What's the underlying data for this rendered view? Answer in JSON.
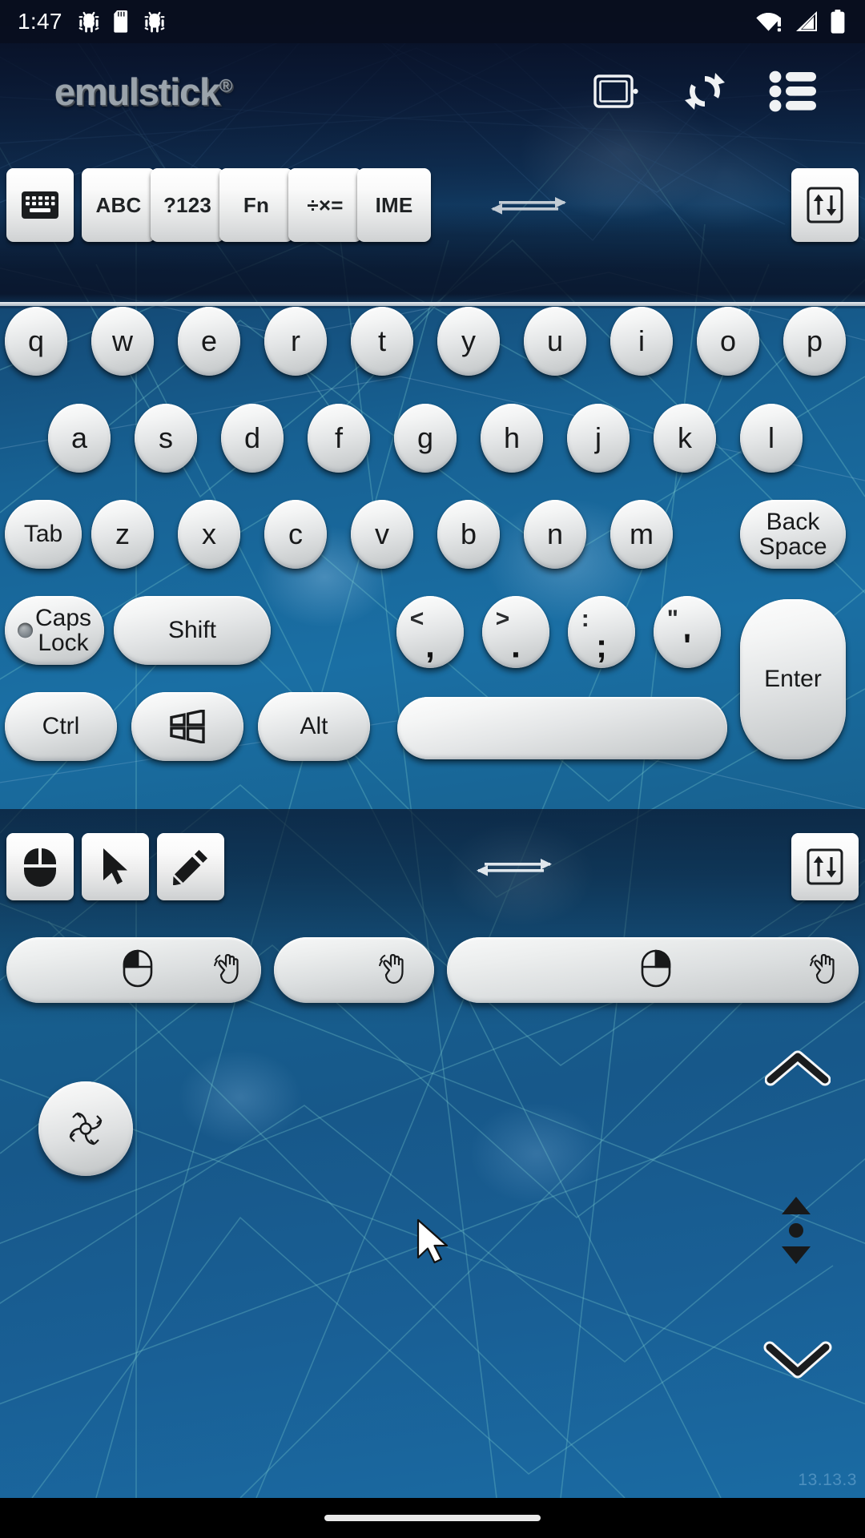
{
  "status_bar": {
    "clock": "1:47",
    "left_icons": [
      "bug-android-icon",
      "sd-card-icon",
      "bug-android-icon"
    ],
    "right_icons": [
      "wifi-no-internet-icon",
      "cellular-signal-icon",
      "battery-full-icon"
    ]
  },
  "header": {
    "logo_text": "emulstick",
    "logo_registered": "®",
    "icons": [
      {
        "name": "device-screen-icon",
        "label": "Device"
      },
      {
        "name": "sync-refresh-icon",
        "label": "Sync"
      },
      {
        "name": "list-menu-icon",
        "label": "Menu"
      }
    ]
  },
  "mode_row": {
    "buttons": [
      {
        "name": "keyboard-toggle",
        "label": "",
        "icon": "keyboard-icon",
        "active": true
      },
      {
        "name": "abc-mode",
        "label": "ABC"
      },
      {
        "name": "num-sym-mode",
        "label": "?123"
      },
      {
        "name": "fn-mode",
        "label": "Fn"
      },
      {
        "name": "math-mode",
        "label": "÷×="
      },
      {
        "name": "ime-mode",
        "label": "IME"
      }
    ],
    "resize_handle": "horizontal-resize-arrows-icon",
    "collapse_button": {
      "name": "keyboard-height-toggle",
      "icon": "up-down-arrows-boxed-icon"
    }
  },
  "keyboard": {
    "row1": [
      "q",
      "w",
      "e",
      "r",
      "t",
      "y",
      "u",
      "i",
      "o",
      "p"
    ],
    "row2": [
      "a",
      "s",
      "d",
      "f",
      "g",
      "h",
      "j",
      "k",
      "l"
    ],
    "row3": {
      "tab": "Tab",
      "letters": [
        "z",
        "x",
        "c",
        "v",
        "b",
        "n",
        "m"
      ],
      "backspace_line1": "Back",
      "backspace_line2": "Space"
    },
    "row4": {
      "caps_line1": "Caps",
      "caps_line2": "Lock",
      "shift": "Shift",
      "punctuation": [
        {
          "upper": "<",
          "lower": ","
        },
        {
          "upper": ">",
          "lower": "."
        },
        {
          "upper": ":",
          "lower": ";"
        },
        {
          "upper": "\"",
          "lower": "'"
        }
      ],
      "enter": "Enter"
    },
    "row5": {
      "ctrl": "Ctrl",
      "win": "windows-logo-icon",
      "alt": "Alt",
      "space": ""
    }
  },
  "mouse_bar": {
    "buttons": [
      {
        "name": "mouse-mode-button",
        "icon": "mouse-icon"
      },
      {
        "name": "pointer-mode-button",
        "icon": "cursor-arrow-icon"
      },
      {
        "name": "pen-mode-button",
        "icon": "pencil-icon"
      }
    ],
    "resize_handle": "horizontal-resize-arrows-icon",
    "collapse_button": {
      "name": "mouse-height-toggle",
      "icon": "up-down-arrows-boxed-icon"
    }
  },
  "mouse_buttons": [
    {
      "name": "left-click-button",
      "icon": "mouse-left-button-icon",
      "gesture": "tap-hand-icon"
    },
    {
      "name": "middle-click-button",
      "icon": "",
      "gesture": "tap-hand-icon"
    },
    {
      "name": "right-click-button",
      "icon": "mouse-right-button-icon",
      "gesture": "tap-hand-icon"
    }
  ],
  "trackpad": {
    "joystick": {
      "name": "scroll-joystick",
      "icon": "four-way-move-icon"
    },
    "scroll_up": "chevron-up-icon",
    "scroll_mid": "scroll-up-down-icon",
    "scroll_down": "chevron-down-icon",
    "cursor": "mouse-cursor-pointer",
    "watermark": "13.13.3"
  },
  "colors": {
    "background_blue": "#1a6fa4",
    "background_dark": "#0e2742",
    "status_bar": "#090e1e",
    "key_face": "#e4e6e7",
    "key_text": "#18191a",
    "logo_gray": "#9aa3ab"
  },
  "nav_bar": {
    "pill": "home-gesture-pill"
  }
}
